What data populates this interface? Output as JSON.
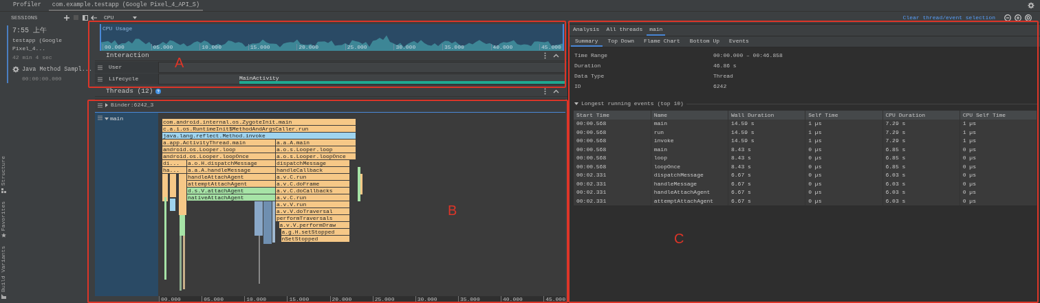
{
  "top_tabs": [
    {
      "label": "Profiler",
      "selected": false
    },
    {
      "label": "com.example.testapp (Google Pixel_4_API_S)",
      "selected": true
    }
  ],
  "side_tool_windows": [
    {
      "label": "Structure",
      "kind": "structure"
    },
    {
      "label": "Favorites",
      "kind": "favorites"
    },
    {
      "label": "Build Variants",
      "kind": "build"
    }
  ],
  "sessions": {
    "title": "SESSIONS",
    "session": {
      "time": "7:55 上午",
      "name": "testapp (Google Pixel_4...",
      "duration": "42 min 4 sec",
      "selected": true
    },
    "recordings": [
      {
        "label": "Java Method Sampl...",
        "time": "00:00:00.000"
      }
    ]
  },
  "toolbar": {
    "profiler": "CPU"
  },
  "clear_link": "Clear thread/event selection",
  "cpu_usage": {
    "title": "CPU Usage",
    "ticks": [
      "00.000",
      "05.000",
      "10.000",
      "15.000",
      "20.000",
      "25.000",
      "30.000",
      "35.000",
      "40.000",
      "45.000"
    ]
  },
  "interaction": {
    "title": "Interaction",
    "tracks": [
      {
        "label": "User"
      },
      {
        "label": "Lifecycle",
        "events": [
          {
            "label": "MainActivity"
          }
        ]
      }
    ]
  },
  "threads": {
    "title": "Threads (12)",
    "items": [
      {
        "label": "Binder:6242_3",
        "expanded": false,
        "selected": false
      },
      {
        "label": "main",
        "expanded": true,
        "selected": true
      }
    ]
  },
  "flame_chart": {
    "events": [
      {
        "label": "com.android.internal.os.ZygoteInit.main",
        "color": "#f6c887"
      },
      {
        "label": "c.a.i.os.RuntimeInit$MethodAndArgsCaller.run",
        "color": "#f6c887"
      },
      {
        "label": "java.lang.reflect.Method.invoke",
        "color": "#9fd4ef"
      },
      {
        "label": "a.app.ActivityThread.main",
        "color": "#f6c887"
      },
      {
        "label": "a.a.A.main",
        "color": "#f6c887"
      },
      {
        "label": "android.os.Looper.loop",
        "color": "#f6c887"
      },
      {
        "label": "a.o.s.Looper.loop",
        "color": "#f6c887"
      },
      {
        "label": "android.os.Looper.loopOnce",
        "color": "#f6c887"
      },
      {
        "label": "a.o.s.Looper.loopOnce",
        "color": "#f6c887"
      },
      {
        "label": "di...",
        "color": "#f6c887"
      },
      {
        "label": "a.o.H.dispatchMessage",
        "color": "#f6c887"
      },
      {
        "label": "dispatchMessage",
        "color": "#f6c887"
      },
      {
        "label": "ha...",
        "color": "#f6c887"
      },
      {
        "label": "a.a.A.handleMessage",
        "color": "#f6c887"
      },
      {
        "label": "handleCallback",
        "color": "#f6c887"
      },
      {
        "label": "handleAttachAgent",
        "color": "#f6c887"
      },
      {
        "label": "a.v.C.run",
        "color": "#f6c887"
      },
      {
        "label": "attemptAttachAgent",
        "color": "#f6c887"
      },
      {
        "label": "a.v.C.doFrame",
        "color": "#f6c887"
      },
      {
        "label": "d.s.V.attachAgent",
        "color": "#a6e3a6"
      },
      {
        "label": "a.v.C.doCallbacks",
        "color": "#f6c887"
      },
      {
        "label": "nativeAttachAgent",
        "color": "#a6e3a6"
      },
      {
        "label": "a.v.C.run",
        "color": "#f6c887"
      },
      {
        "label": "a.v.V.run",
        "color": "#f6c887"
      },
      {
        "label": "a.v.V.doTraversal",
        "color": "#f6c887"
      },
      {
        "label": "performTraversals",
        "color": "#f6c887"
      },
      {
        "label": "a.v.V.performDraw",
        "color": "#f6c887"
      },
      {
        "label": "a.g.H.setStopped",
        "color": "#f6c887"
      },
      {
        "label": "nSetStopped",
        "color": "#f6c887"
      }
    ]
  },
  "time_axis": [
    "00.000",
    "05.000",
    "10.000",
    "15.000",
    "20.000",
    "25.000",
    "30.000",
    "35.000",
    "40.000",
    "45.000"
  ],
  "analysis": {
    "tabs": [
      {
        "label": "Analysis",
        "selected": false
      },
      {
        "label": "All threads",
        "selected": false
      },
      {
        "label": "main",
        "selected": true
      }
    ],
    "subtabs": [
      {
        "label": "Summary",
        "selected": true
      },
      {
        "label": "Top Down",
        "selected": false
      },
      {
        "label": "Flame Chart",
        "selected": false
      },
      {
        "label": "Bottom Up",
        "selected": false
      },
      {
        "label": "Events",
        "selected": false
      }
    ],
    "summary": [
      {
        "label": "Time Range",
        "value": "00:00.000 – 00:46.858"
      },
      {
        "label": "Duration",
        "value": "46.86 s"
      },
      {
        "label": "Data Type",
        "value": "Thread"
      },
      {
        "label": "ID",
        "value": "6242"
      }
    ],
    "events_section": {
      "title": "Longest running events (top 10)",
      "expanded": true
    },
    "table": {
      "columns": [
        "Start Time",
        "Name",
        "Wall Duration",
        "Self Time",
        "CPU Duration",
        "CPU Self Time"
      ],
      "rows": [
        [
          "00:00.568",
          "main",
          "14.59 s",
          "1 µs",
          "7.29 s",
          "1 µs"
        ],
        [
          "00:00.568",
          "run",
          "14.59 s",
          "1 µs",
          "7.29 s",
          "1 µs"
        ],
        [
          "00:00.568",
          "invoke",
          "14.59 s",
          "1 µs",
          "7.29 s",
          "1 µs"
        ],
        [
          "00:00.568",
          "main",
          "8.43 s",
          "0 µs",
          "6.85 s",
          "0 µs"
        ],
        [
          "00:00.568",
          "loop",
          "8.43 s",
          "0 µs",
          "6.85 s",
          "0 µs"
        ],
        [
          "00:00.568",
          "loopOnce",
          "8.43 s",
          "0 µs",
          "6.85 s",
          "0 µs"
        ],
        [
          "00:02.331",
          "dispatchMessage",
          "6.67 s",
          "0 µs",
          "6.03 s",
          "0 µs"
        ],
        [
          "00:02.331",
          "handleMessage",
          "6.67 s",
          "0 µs",
          "6.03 s",
          "0 µs"
        ],
        [
          "00:02.331",
          "handleAttachAgent",
          "6.67 s",
          "0 µs",
          "6.03 s",
          "0 µs"
        ],
        [
          "00:02.331",
          "attemptAttachAgent",
          "6.67 s",
          "0 µs",
          "6.03 s",
          "0 µs"
        ]
      ]
    }
  },
  "annotations": [
    {
      "label": "A"
    },
    {
      "label": "B"
    },
    {
      "label": "C"
    }
  ]
}
